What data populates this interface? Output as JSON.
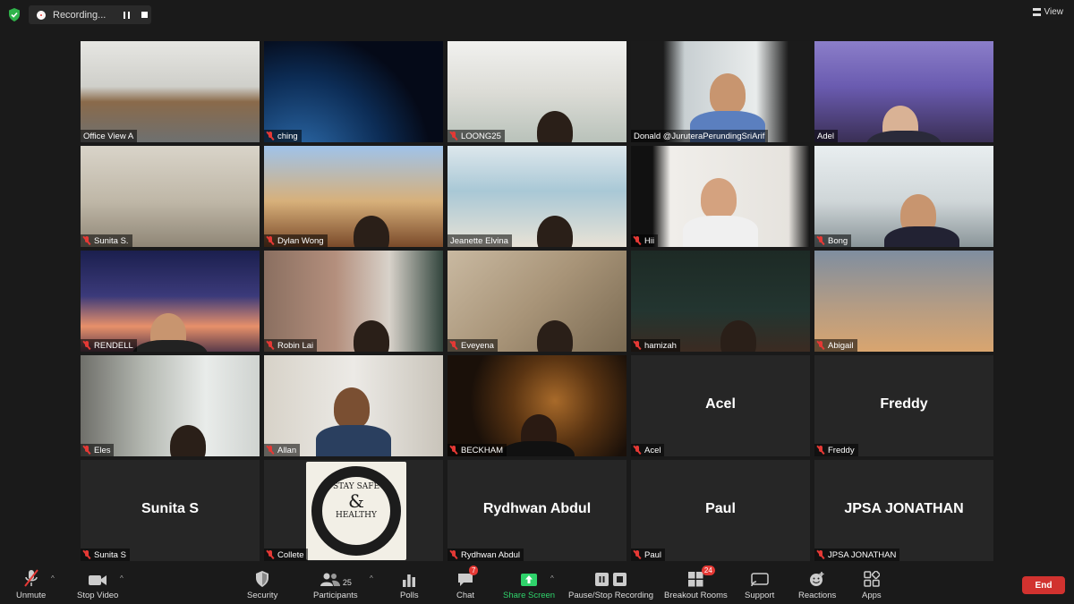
{
  "topbar": {
    "recording_label": "Recording...",
    "view_label": "View"
  },
  "participants": [
    {
      "name": "Office View A",
      "muted": false,
      "active": false,
      "bg": "office"
    },
    {
      "name": "ching",
      "muted": true,
      "active": false,
      "bg": "space"
    },
    {
      "name": "LOONG25",
      "muted": true,
      "active": false,
      "bg": "room"
    },
    {
      "name": "Donald @JuruteraPerundingSriArif",
      "muted": false,
      "active": true,
      "bg": "speaker"
    },
    {
      "name": "Adel",
      "muted": false,
      "active": false,
      "bg": "wisteria"
    },
    {
      "name": "Sunita S.",
      "muted": true,
      "active": false,
      "bg": "window"
    },
    {
      "name": "Dylan Wong",
      "muted": true,
      "active": false,
      "bg": "castle"
    },
    {
      "name": "Jeanette Elvina",
      "muted": false,
      "active": false,
      "bg": "beach"
    },
    {
      "name": "Hii",
      "muted": true,
      "active": false,
      "bg": "shelf"
    },
    {
      "name": "Bong",
      "muted": true,
      "active": false,
      "bg": "openoffice"
    },
    {
      "name": "RENDELL",
      "muted": true,
      "active": false,
      "bg": "sunset"
    },
    {
      "name": "Robin Lai",
      "muted": true,
      "active": false,
      "bg": "curtain"
    },
    {
      "name": "Eveyena",
      "muted": true,
      "active": false,
      "bg": "plant"
    },
    {
      "name": "hamizah",
      "muted": true,
      "active": false,
      "bg": "lamps"
    },
    {
      "name": "Abigail",
      "muted": true,
      "active": false,
      "bg": "ride"
    },
    {
      "name": "Eles",
      "muted": true,
      "active": false,
      "bg": "curtain2"
    },
    {
      "name": "Allan",
      "muted": true,
      "active": false,
      "bg": "studio"
    },
    {
      "name": "BECKHAM",
      "muted": true,
      "active": false,
      "bg": "lion"
    },
    {
      "name": "Acel",
      "muted": true,
      "active": false,
      "bg": "none",
      "display": "Acel"
    },
    {
      "name": "Freddy",
      "muted": true,
      "active": false,
      "bg": "none",
      "display": "Freddy"
    },
    {
      "name": "Sunita S",
      "muted": true,
      "active": false,
      "bg": "none",
      "display": "Sunita S"
    },
    {
      "name": "Collete",
      "muted": true,
      "active": false,
      "bg": "poster"
    },
    {
      "name": "Rydhwan Abdul",
      "muted": true,
      "active": false,
      "bg": "none",
      "display": "Rydhwan Abdul"
    },
    {
      "name": "Paul",
      "muted": true,
      "active": false,
      "bg": "none",
      "display": "Paul"
    },
    {
      "name": "JPSA JONATHAN",
      "muted": true,
      "active": false,
      "bg": "none",
      "display": "JPSA JONATHAN"
    }
  ],
  "poster": {
    "top_text": "WEAR A MASK · KEEP SOCIAL DISTANCE",
    "bottom_text": "SANITIZE HANDS OFTEN",
    "line1": "STAY SAFE",
    "amp": "&",
    "line2": "HEALTHY"
  },
  "toolbar": {
    "unmute": "Unmute",
    "stop_video": "Stop Video",
    "security": "Security",
    "participants": "Participants",
    "participants_count": "25",
    "polls": "Polls",
    "chat": "Chat",
    "chat_badge": "7",
    "share_screen": "Share Screen",
    "recording": "Pause/Stop Recording",
    "breakout": "Breakout Rooms",
    "breakout_badge": "24",
    "support": "Support",
    "reactions": "Reactions",
    "apps": "Apps",
    "end": "End"
  },
  "colors": {
    "active_border": "#e6ec5a",
    "muted_red": "#e53935",
    "share_green": "#2fd36b",
    "end_red": "#d1322f"
  }
}
